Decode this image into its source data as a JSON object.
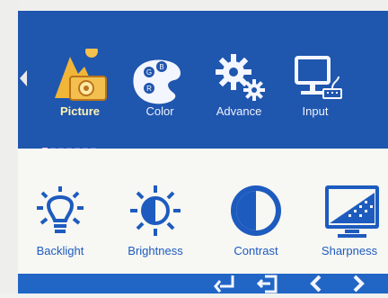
{
  "top_menu": [
    {
      "label": "Picture",
      "selected": true,
      "icon": "picture-mountain-camera-icon"
    },
    {
      "label": "Color",
      "selected": false,
      "icon": "color-palette-icon"
    },
    {
      "label": "Advance",
      "selected": false,
      "icon": "advance-gears-icon"
    },
    {
      "label": "Input",
      "selected": false,
      "icon": "input-computer-icon"
    }
  ],
  "page_indicator": {
    "current": 1,
    "total": 7
  },
  "submenu": [
    {
      "label": "Backlight",
      "icon": "backlight-bulb-icon"
    },
    {
      "label": "Brightness",
      "icon": "brightness-sun-icon"
    },
    {
      "label": "Contrast",
      "icon": "contrast-circle-icon"
    },
    {
      "label": "Sharpness",
      "icon": "sharpness-monitor-icon"
    }
  ],
  "bottom_controls": [
    {
      "icon": "enter-arrow-icon"
    },
    {
      "icon": "return-icon"
    },
    {
      "icon": "chevron-left-icon"
    },
    {
      "icon": "chevron-right-icon"
    }
  ],
  "colors": {
    "menu_bar": "#1f56ae",
    "selected_label": "#fff3b6",
    "submenu_label": "#1d5bbf",
    "bottom_bar": "#2166c5"
  }
}
